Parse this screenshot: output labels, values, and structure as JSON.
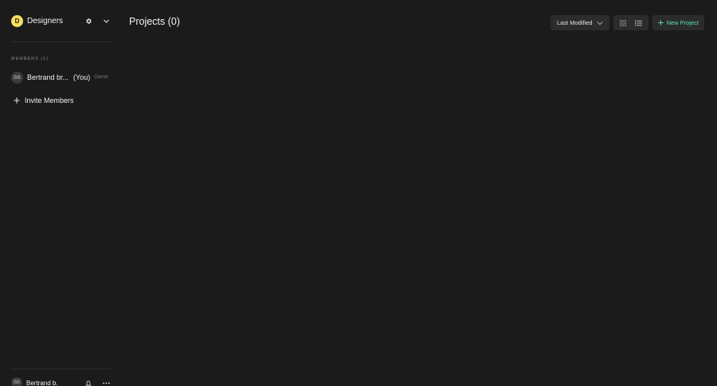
{
  "sidebar": {
    "team": {
      "avatar_letter": "D",
      "name": "Designers",
      "settings_icon": "gear-icon",
      "menu_icon": "chevron-down-icon"
    },
    "members_header": "MEMBERS (1)",
    "members": [
      {
        "initials": "BB",
        "name": "Bertrand br...",
        "you_label": "(You)",
        "role": "Owner"
      }
    ],
    "invite": {
      "icon": "plus-icon",
      "label": "Invite Members"
    },
    "user": {
      "initials": "BB",
      "name": "Bertrand b.",
      "notifications_icon": "bell-icon",
      "more_icon": "more-horizontal-icon"
    }
  },
  "main": {
    "title": "Projects (0)",
    "sort": {
      "label": "Last Modified",
      "icon": "chevron-down-icon"
    },
    "view_toggle": {
      "grid_icon": "grid-icon",
      "list_icon": "list-icon"
    },
    "new_project": {
      "icon": "plus-icon",
      "label": "New Project"
    }
  },
  "colors": {
    "background": "#1b1b1b",
    "team_avatar": "#f6e05e",
    "accent_green": "#5ee0a6",
    "button_bg": "#2c2c2c"
  }
}
